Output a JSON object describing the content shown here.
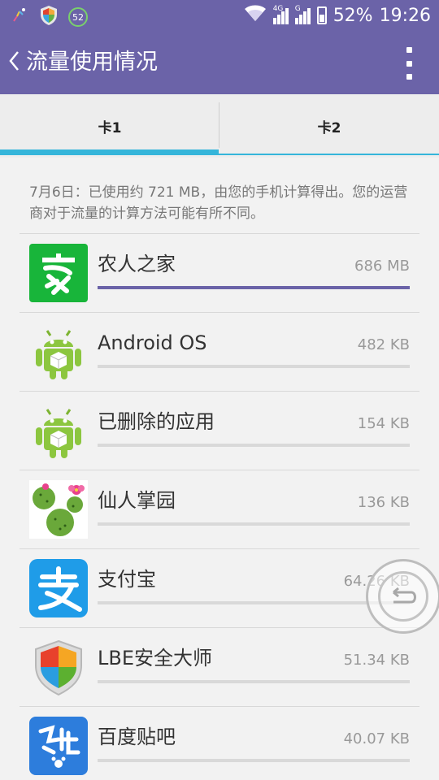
{
  "status_bar": {
    "battery_percent": "52%",
    "time": "19:26",
    "notification_count": "52",
    "signal_1_label": "4G",
    "signal_2_label": "G"
  },
  "header": {
    "title": "流量使用情况",
    "back_icon": "chevron-left-icon",
    "menu_icon": "more-vert-icon"
  },
  "tabs": [
    {
      "label": "卡1",
      "selected": true
    },
    {
      "label": "卡2",
      "selected": false
    }
  ],
  "summary": "7月6日：已使用约 721 MB，由您的手机计算得出。您的运营商对于流量的计算方法可能有所不同。",
  "apps": [
    {
      "name": "农人之家",
      "usage": "686 MB",
      "share": 1.0,
      "icon": "nongren-app-icon"
    },
    {
      "name": "Android OS",
      "usage": "482 KB",
      "share": 0.0,
      "icon": "android-icon"
    },
    {
      "name": "已删除的应用",
      "usage": "154 KB",
      "share": 0.0,
      "icon": "android-icon"
    },
    {
      "name": "仙人掌园",
      "usage": "136 KB",
      "share": 0.0,
      "icon": "cactus-app-icon"
    },
    {
      "name": "支付宝",
      "usage": "64.26 KB",
      "share": 0.0,
      "icon": "alipay-icon"
    },
    {
      "name": "LBE安全大师",
      "usage": "51.34 KB",
      "share": 0.0,
      "icon": "shield-icon"
    },
    {
      "name": "百度贴吧",
      "usage": "40.07 KB",
      "share": 0.0,
      "icon": "tieba-icon"
    }
  ],
  "colors": {
    "accent": "#6b63a8",
    "tab_indicator": "#35b5da"
  }
}
